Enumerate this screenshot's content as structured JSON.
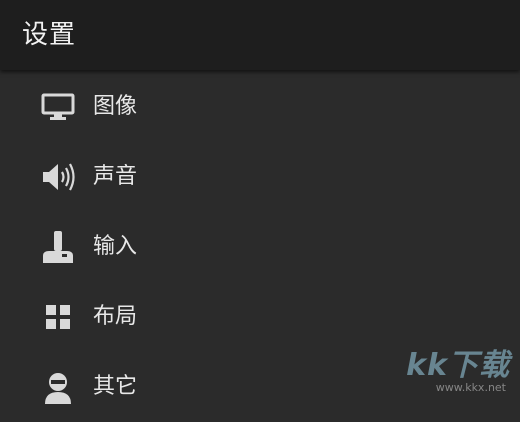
{
  "header": {
    "title": "设置"
  },
  "menu": {
    "items": [
      {
        "label": "图像",
        "icon": "monitor-icon"
      },
      {
        "label": "声音",
        "icon": "speaker-icon"
      },
      {
        "label": "输入",
        "icon": "joystick-icon"
      },
      {
        "label": "布局",
        "icon": "grid-icon"
      },
      {
        "label": "其它",
        "icon": "user-icon"
      }
    ]
  },
  "watermark": {
    "logo": "kk下载",
    "url": "www.kkx.net"
  },
  "colors": {
    "header_bg": "#1e1e1e",
    "panel_bg": "#2b2b2b",
    "text": "#e8e8e8",
    "icon": "#d9d9d9"
  }
}
